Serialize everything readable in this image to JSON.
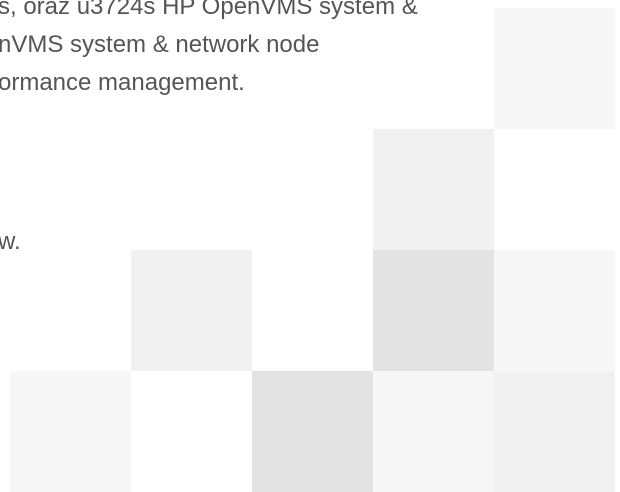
{
  "content": {
    "lines": [
      "s, oraz u3724s HP OpenVMS system &",
      "nVMS system & network node",
      "ormance management.",
      "w."
    ]
  },
  "colors": {
    "text": "#555555",
    "tile_light": "#f7f7f7",
    "tile_mid": "#f1f1f1",
    "tile_dark": "#e3e3e3",
    "background": "#ffffff"
  }
}
